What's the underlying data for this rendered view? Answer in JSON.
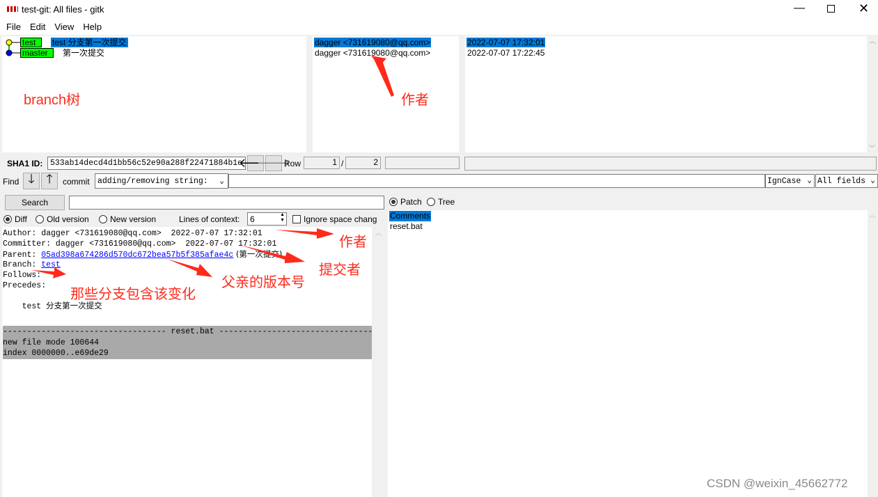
{
  "window": {
    "title": "test-git: All files - gitk",
    "controls": [
      "minimize",
      "maximize",
      "close"
    ]
  },
  "menu": [
    "File",
    "Edit",
    "View",
    "Help"
  ],
  "commits": [
    {
      "branch": "test",
      "branch_color": "#00ff00",
      "dot_color": "#ffff00",
      "subject": "test 分支第一次提交",
      "author": "dagger <731619080@qq.com>",
      "date": "2022-07-07 17:32:01",
      "selected": true
    },
    {
      "branch": "master",
      "branch_color": "#00ff00",
      "dot_color": "#0000ff",
      "subject": "第一次提交",
      "author": "dagger <731619080@qq.com>",
      "date": "2022-07-07 17:22:45",
      "selected": false
    }
  ],
  "annotations": {
    "branch_tree": "branch树",
    "author1": "作者",
    "author2": "作者",
    "committer": "提交者",
    "parent": "父亲的版本号",
    "branches": "那些分支包含该变化"
  },
  "sha": {
    "label": "SHA1 ID:",
    "value": "533ab14decd4d1bb56c52e90a288f22471884b1e",
    "row_label": "Row",
    "row": "1",
    "sep": "/",
    "total": "2"
  },
  "find": {
    "label": "Find",
    "type": "commit",
    "mode": "adding/removing string:",
    "case": "IgnCase",
    "fields": "All fields"
  },
  "search": {
    "button": "Search",
    "value": ""
  },
  "diffopts": {
    "diff": "Diff",
    "old": "Old version",
    "new": "New version",
    "context_label": "Lines of context:",
    "context": "6",
    "ignore": "Ignore space chang"
  },
  "details": {
    "author": "Author: dagger <731619080@qq.com>  2022-07-07 17:32:01",
    "committer": "Committer: dagger <731619080@qq.com>  2022-07-07 17:32:01",
    "parent_label": "Parent: ",
    "parent_sha": "05ad398a674286d570dc672bea57b5f385afae4c",
    "parent_subject": " (第一次提交)",
    "branch_label": "Branch: ",
    "branch": "test",
    "follows": "Follows:",
    "precedes": "Precedes:",
    "message": "    test 分支第一次提交",
    "file_header": "---------------------------------- reset.bat ----------------------------------",
    "mode": "new file mode 100644",
    "index": "index 0000000..e69de29"
  },
  "filelist": {
    "patch": "Patch",
    "tree": "Tree",
    "items": [
      "Comments",
      "reset.bat"
    ]
  },
  "watermark": "CSDN @weixin_45662772"
}
